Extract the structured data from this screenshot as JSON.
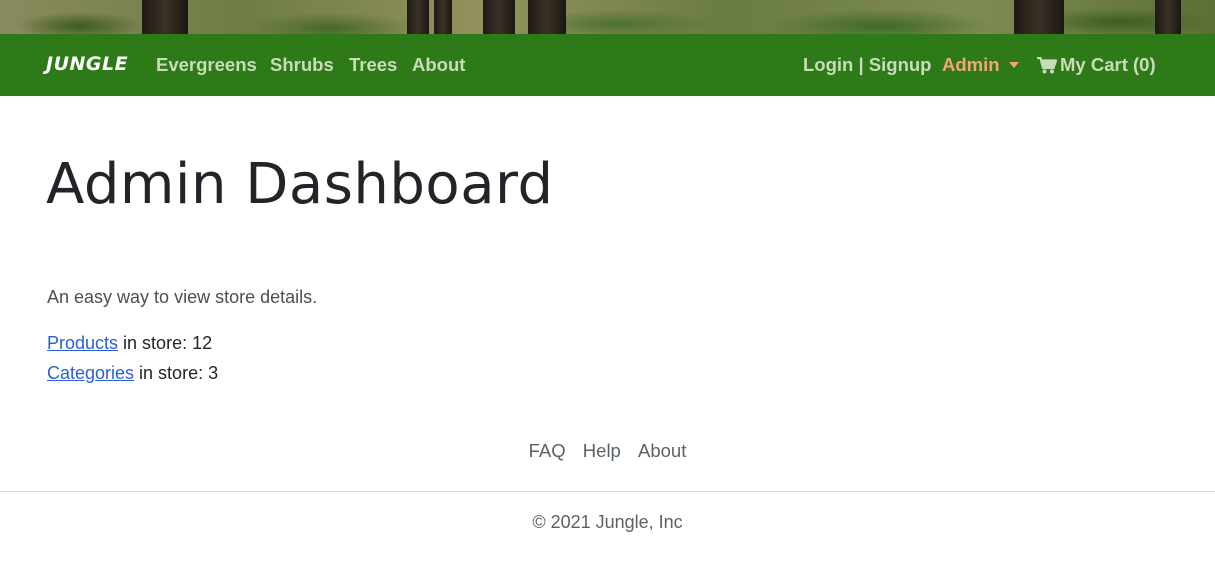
{
  "navbar": {
    "brand": "JUNGLE",
    "links": [
      "Evergreens",
      "Shrubs",
      "Trees",
      "About"
    ],
    "auth": "Login | Signup",
    "admin": "Admin",
    "cart": "My Cart (0)"
  },
  "main": {
    "title": "Admin Dashboard",
    "lead": "An easy way to view store details.",
    "stats": [
      {
        "link": "Products",
        "text": " in store: 12"
      },
      {
        "link": "Categories",
        "text": " in store: 3"
      }
    ]
  },
  "footer": {
    "links": [
      "FAQ",
      "Help",
      "About"
    ],
    "copyright": "© 2021 Jungle, Inc"
  },
  "colors": {
    "navbar": "#2e7a18",
    "nav_link": "#c8dcb8",
    "admin_accent": "#f2a47e",
    "link": "#2b5fd9"
  },
  "icons": {
    "cart": "shopping-cart-icon",
    "admin_dropdown": "caret-down-icon"
  }
}
